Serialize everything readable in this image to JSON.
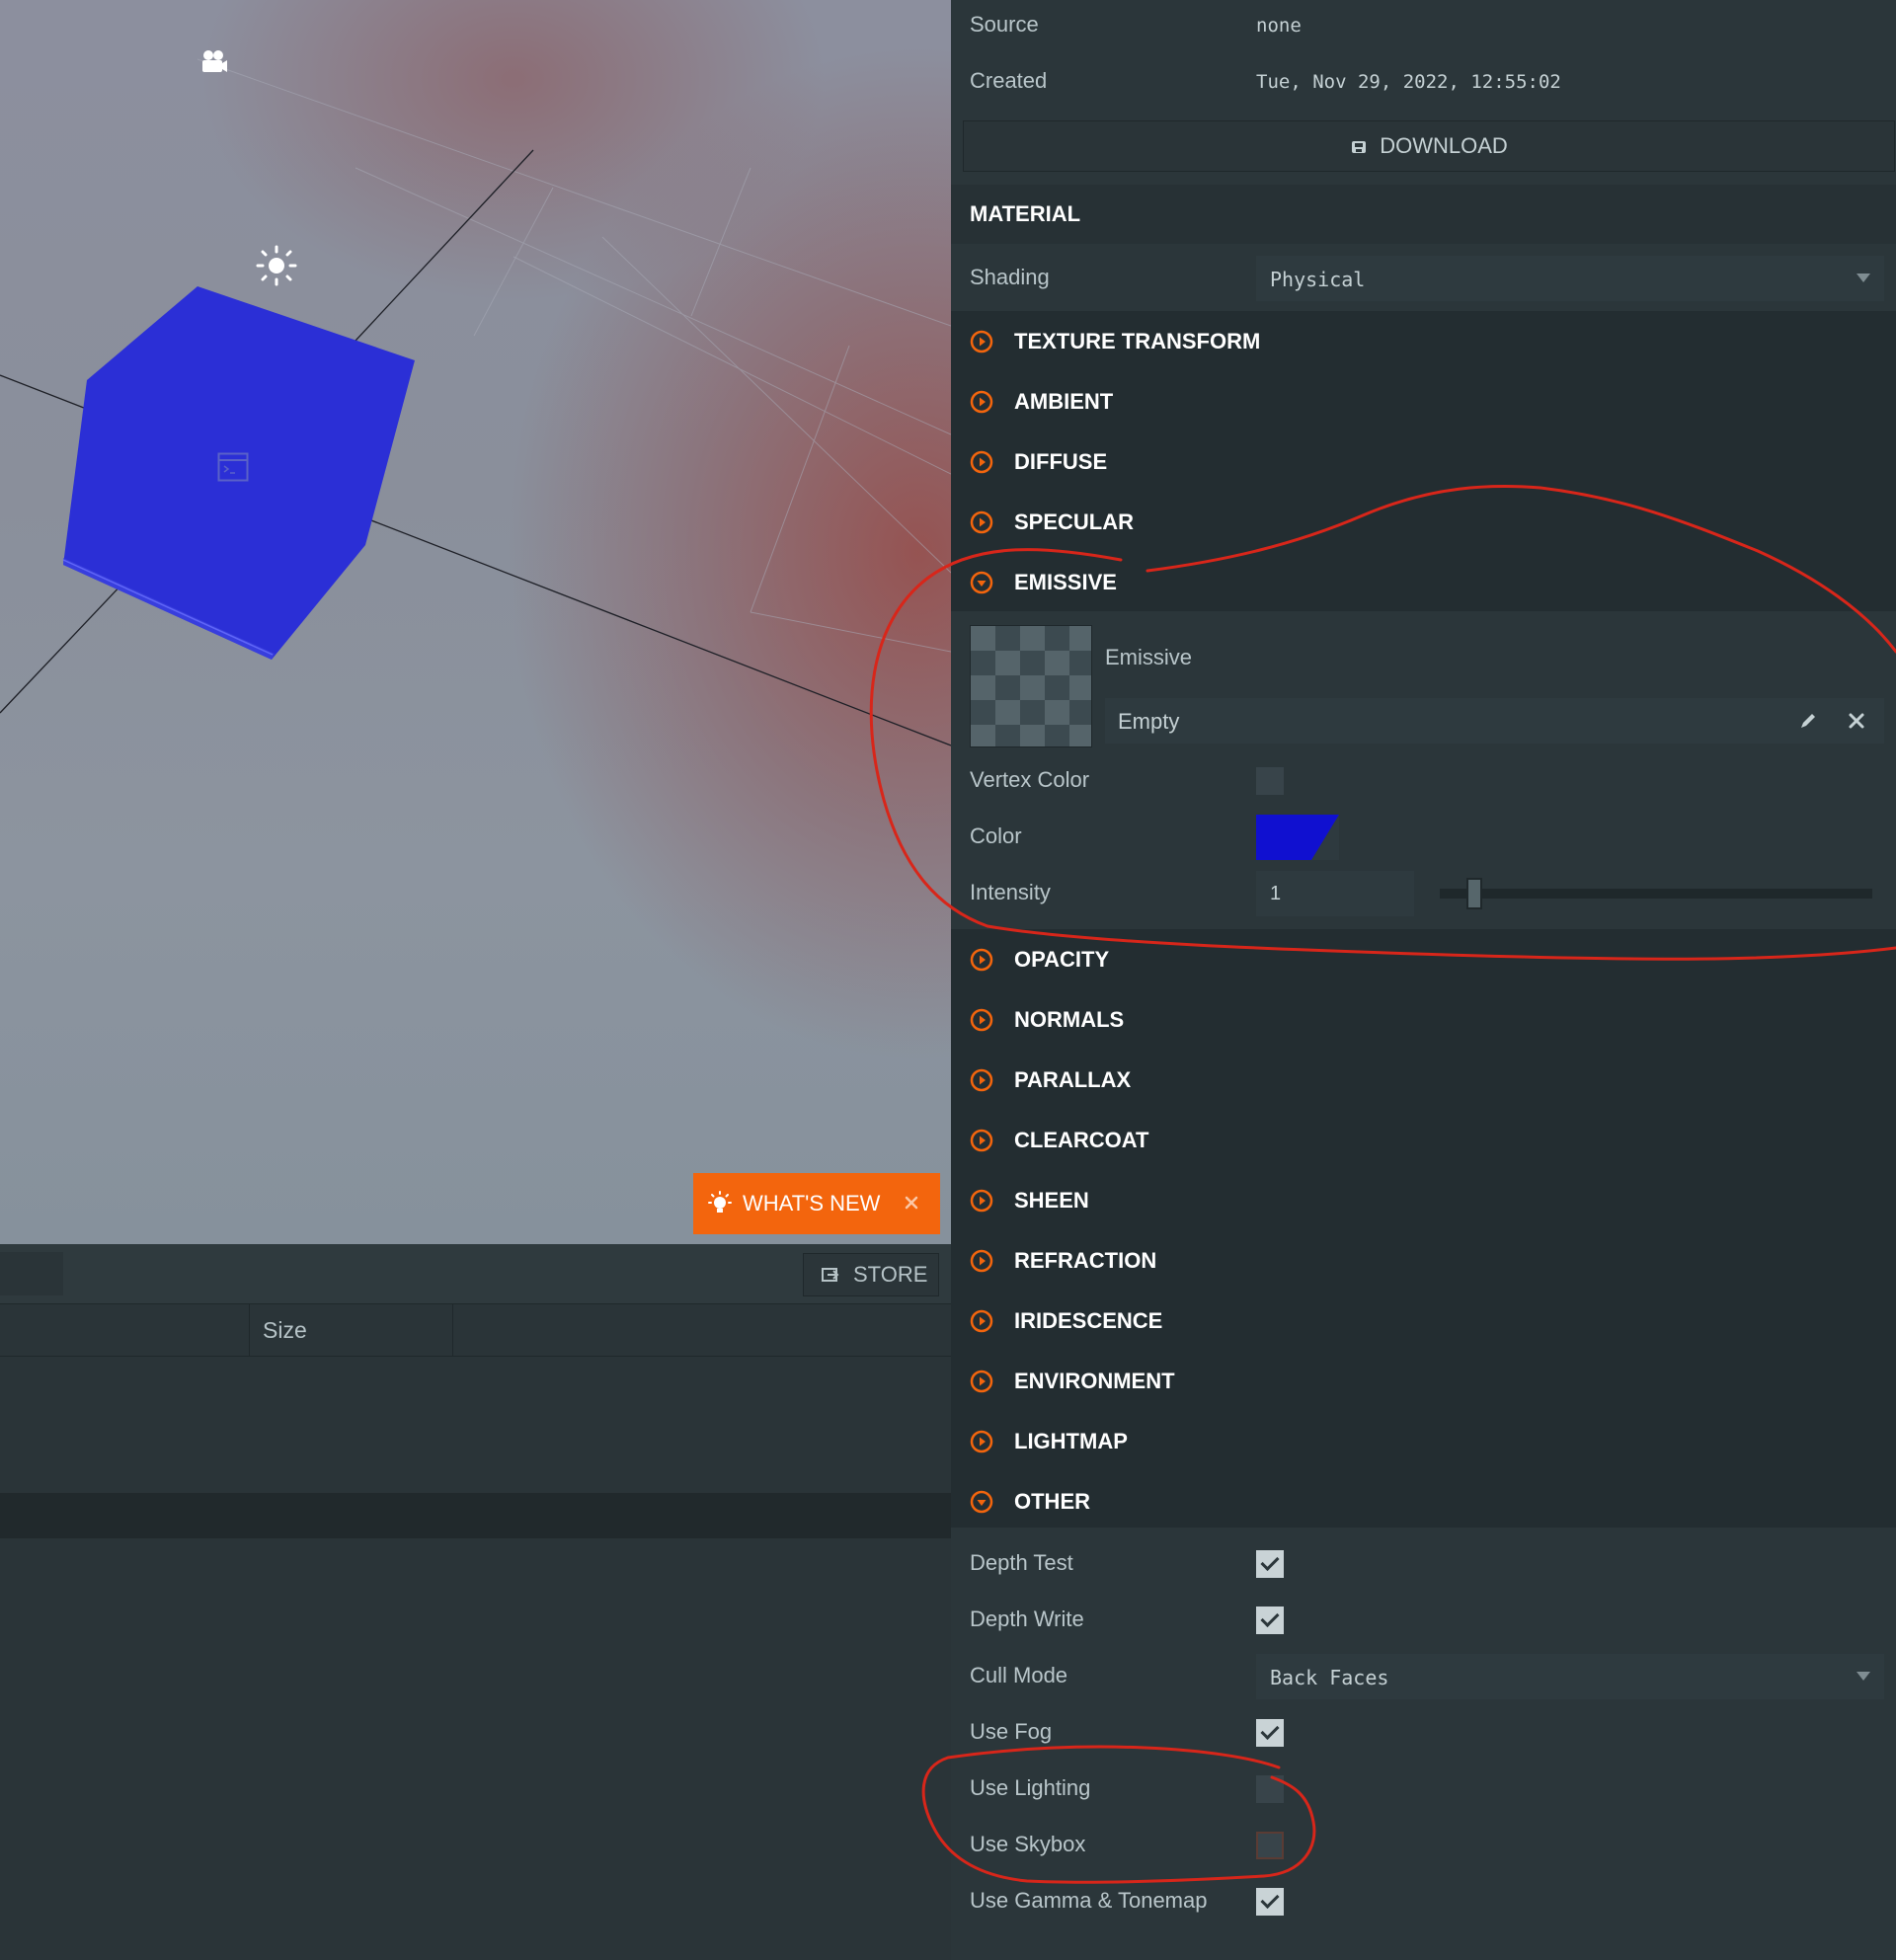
{
  "inspector": {
    "source_label": "Source",
    "source_value": "none",
    "created_label": "Created",
    "created_value": "Tue, Nov 29, 2022, 12:55:02",
    "download_label": "DOWNLOAD",
    "material_title": "MATERIAL",
    "shading_label": "Shading",
    "shading_value": "Physical",
    "groups": {
      "texture_transform": "TEXTURE TRANSFORM",
      "ambient": "AMBIENT",
      "diffuse": "DIFFUSE",
      "specular": "SPECULAR",
      "emissive": "EMISSIVE",
      "opacity": "OPACITY",
      "normals": "NORMALS",
      "parallax": "PARALLAX",
      "clearcoat": "CLEARCOAT",
      "sheen": "SHEEN",
      "refraction": "REFRACTION",
      "iridescence": "IRIDESCENCE",
      "environment": "ENVIRONMENT",
      "lightmap": "LIGHTMAP",
      "other": "OTHER"
    },
    "emissive": {
      "map_label": "Emissive",
      "map_value": "Empty",
      "vertex_color_label": "Vertex Color",
      "vertex_color_checked": false,
      "color_label": "Color",
      "color_value": "#1010d0",
      "intensity_label": "Intensity",
      "intensity_value": "1"
    },
    "other": {
      "depth_test_label": "Depth Test",
      "depth_test_checked": true,
      "depth_write_label": "Depth Write",
      "depth_write_checked": true,
      "cull_mode_label": "Cull Mode",
      "cull_mode_value": "Back Faces",
      "use_fog_label": "Use Fog",
      "use_fog_checked": true,
      "use_lighting_label": "Use Lighting",
      "use_lighting_checked": false,
      "use_skybox_label": "Use Skybox",
      "use_skybox_checked": false,
      "use_gamma_label": "Use Gamma & Tonemap",
      "use_gamma_checked": true
    }
  },
  "viewport": {
    "whats_new_label": "WHAT'S NEW",
    "cube_color": "#2b2fd6"
  },
  "assets": {
    "store_label": "STORE",
    "size_column": "Size"
  },
  "colors": {
    "accent": "#f3650d",
    "annotation": "#d8261a"
  }
}
